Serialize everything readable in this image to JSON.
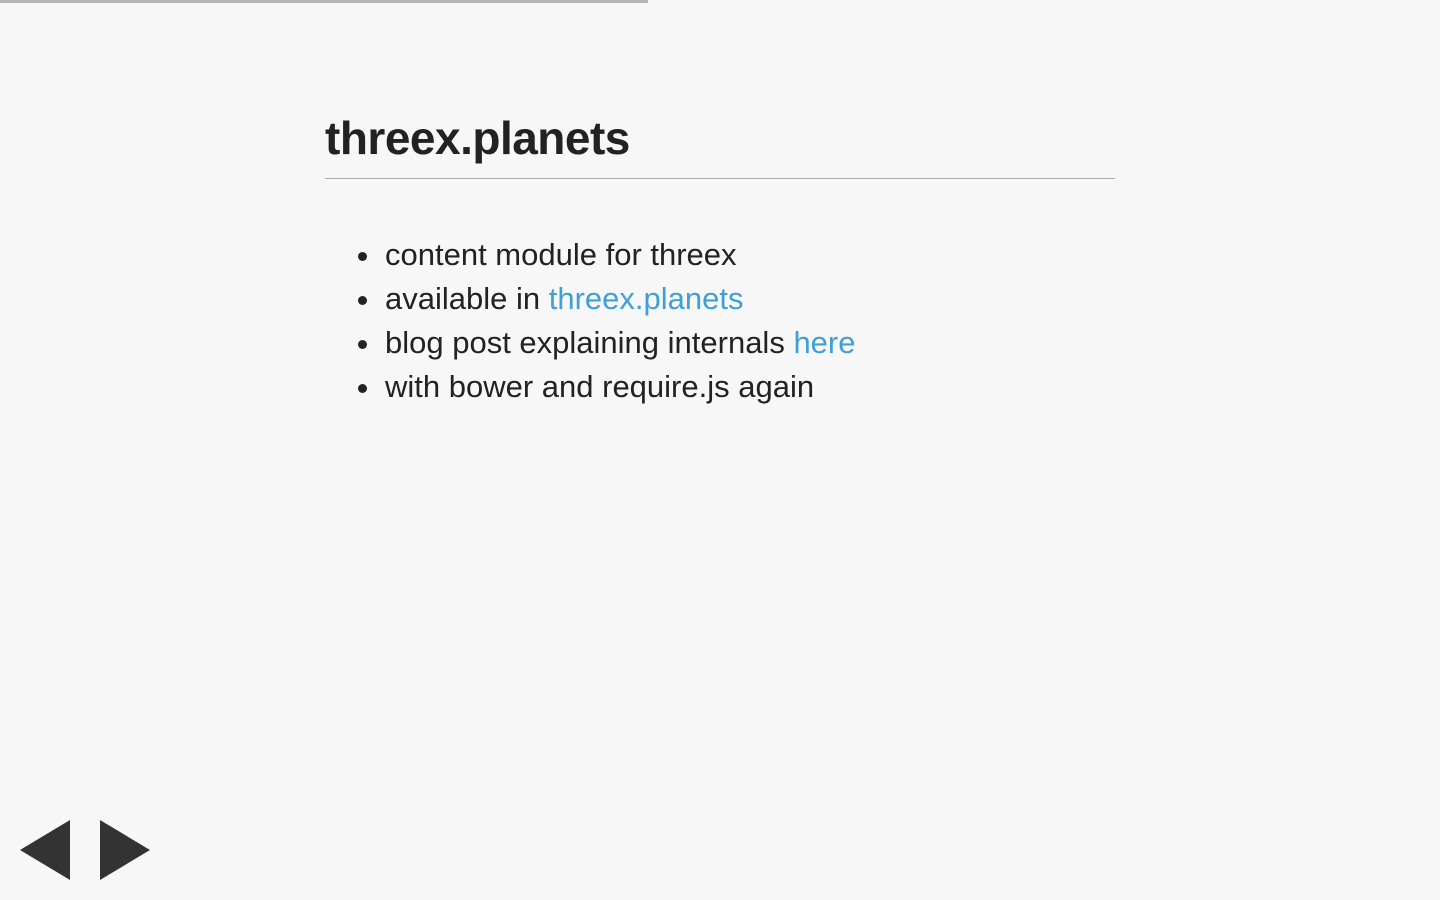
{
  "progress": {
    "fraction": 0.45
  },
  "slide": {
    "title": "threex.planets",
    "bullets": [
      {
        "text": "content module for threex",
        "link": ""
      },
      {
        "text": "available in ",
        "link": "threex.planets"
      },
      {
        "text": "blog post explaining internals ",
        "link": "here"
      },
      {
        "text": "with bower and require.js again",
        "link": ""
      }
    ]
  },
  "nav": {
    "prev_icon": "triangle-left-icon",
    "next_icon": "triangle-right-icon"
  },
  "colors": {
    "background": "#f7f7f7",
    "text": "#222222",
    "link": "#3fa0d8",
    "progress": "#b5b5b5",
    "nav_arrow": "#333333"
  }
}
